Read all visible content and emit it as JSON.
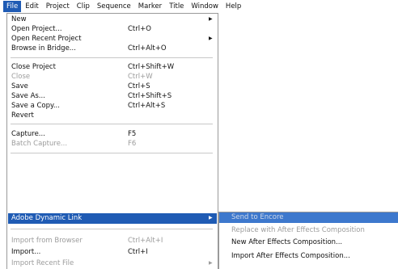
{
  "menubar": {
    "items": [
      {
        "label": "File"
      },
      {
        "label": "Edit"
      },
      {
        "label": "Project"
      },
      {
        "label": "Clip"
      },
      {
        "label": "Sequence"
      },
      {
        "label": "Marker"
      },
      {
        "label": "Title"
      },
      {
        "label": "Window"
      },
      {
        "label": "Help"
      }
    ]
  },
  "file_menu": {
    "items": [
      {
        "label": "New",
        "shortcut": "",
        "submenu_arrow": "▶"
      },
      {
        "label": "Open Project...",
        "shortcut": "Ctrl+O"
      },
      {
        "label": "Open Recent Project",
        "shortcut": "",
        "submenu_arrow": "▶"
      },
      {
        "label": "Browse in Bridge...",
        "shortcut": "Ctrl+Alt+O"
      },
      {
        "label": "Close Project",
        "shortcut": "Ctrl+Shift+W"
      },
      {
        "label": "Close",
        "shortcut": "Ctrl+W"
      },
      {
        "label": "Save",
        "shortcut": "Ctrl+S"
      },
      {
        "label": "Save As...",
        "shortcut": "Ctrl+Shift+S"
      },
      {
        "label": "Save a Copy...",
        "shortcut": "Ctrl+Alt+S"
      },
      {
        "label": "Revert",
        "shortcut": ""
      },
      {
        "label": "Capture...",
        "shortcut": "F5"
      },
      {
        "label": "Batch Capture...",
        "shortcut": "F6"
      },
      {
        "label": "Adobe Dynamic Link",
        "shortcut": "",
        "submenu_arrow": "▶"
      },
      {
        "label": "Import from Browser",
        "shortcut": "Ctrl+Alt+I"
      },
      {
        "label": "Import...",
        "shortcut": "Ctrl+I"
      },
      {
        "label": "Import Recent File",
        "shortcut": "",
        "submenu_arrow": "▶"
      }
    ]
  },
  "dynamic_link_submenu": {
    "items": [
      {
        "label": "Send to Encore"
      },
      {
        "label": "Replace with After Effects Composition"
      },
      {
        "label": "New After Effects Composition..."
      },
      {
        "label": "Import After Effects Composition..."
      }
    ]
  }
}
